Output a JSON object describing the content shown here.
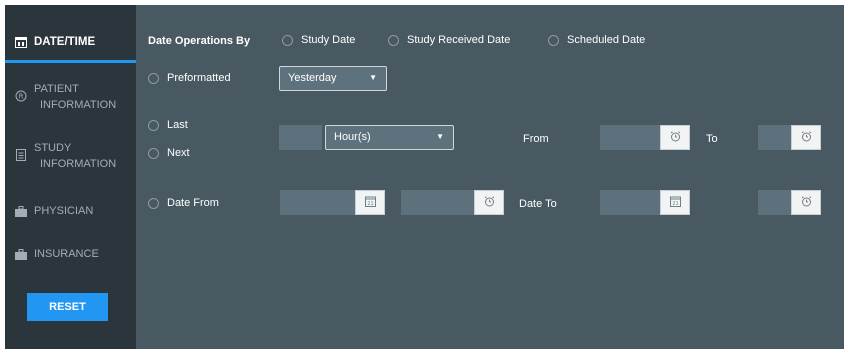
{
  "sidebar": {
    "items": [
      {
        "label": "DATE/TIME",
        "icon": "calendar-icon"
      },
      {
        "label_line1": "PATIENT",
        "label_line2": "INFORMATION",
        "icon": "registered-icon"
      },
      {
        "label_line1": "STUDY",
        "label_line2": "INFORMATION",
        "icon": "document-icon"
      },
      {
        "label": "PHYSICIAN",
        "icon": "briefcase-icon"
      },
      {
        "label": "INSURANCE",
        "icon": "briefcase-icon"
      }
    ],
    "reset_label": "RESET"
  },
  "form": {
    "operations_label": "Date Operations By",
    "operations_options": [
      "Study Date",
      "Study Received Date",
      "Scheduled Date"
    ],
    "preformatted_label": "Preformatted",
    "preformatted_value": "Yesterday",
    "last_label": "Last",
    "next_label": "Next",
    "unit_value": "Hour(s)",
    "from_label": "From",
    "to_label": "To",
    "date_from_label": "Date From",
    "date_to_label": "Date To",
    "calendar_glyph": "21"
  },
  "colors": {
    "background": "#485962",
    "sidebar": "#2b363c",
    "accent": "#2196f3",
    "field": "#5d717c"
  }
}
